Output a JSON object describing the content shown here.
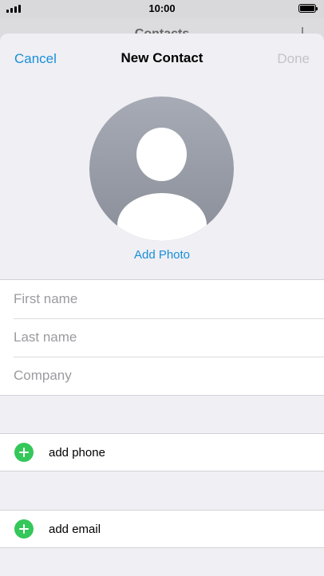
{
  "status_bar": {
    "time": "10:00"
  },
  "background": {
    "title": "Contacts"
  },
  "nav": {
    "cancel_label": "Cancel",
    "title": "New Contact",
    "done_label": "Done"
  },
  "photo": {
    "add_photo_label": "Add Photo",
    "icon": "person-silhouette-icon"
  },
  "name_fields": {
    "first_name_placeholder": "First name",
    "last_name_placeholder": "Last name",
    "company_placeholder": "Company"
  },
  "rows": {
    "add_phone_label": "add phone",
    "add_email_label": "add email"
  },
  "colors": {
    "accent": "#1a8fd8",
    "add_green": "#34c759",
    "done_disabled": "#c4c4c8"
  }
}
